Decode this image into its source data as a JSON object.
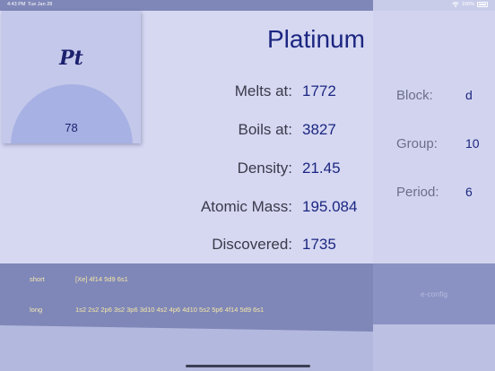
{
  "status_bar": {
    "time": "4:43 PM",
    "date": "Tue Jan 28",
    "battery": "100%"
  },
  "element": {
    "symbol": "Pt",
    "name": "Platinum",
    "atomic_number": "78"
  },
  "properties": [
    {
      "label": "Melts at:",
      "value": "1772"
    },
    {
      "label": "Boils at:",
      "value": "3827"
    },
    {
      "label": "Density:",
      "value": "21.45"
    },
    {
      "label": "Atomic Mass:",
      "value": "195.084"
    },
    {
      "label": "Discovered:",
      "value": "1735"
    }
  ],
  "side_properties": [
    {
      "label": "Block:",
      "value": "d"
    },
    {
      "label": "Group:",
      "value": "10"
    },
    {
      "label": "Period:",
      "value": "6"
    }
  ],
  "econfig": {
    "title": "e-config",
    "short_label": "short",
    "short_value": "[Xe] 4f14 5d9 6s1",
    "long_label": "long",
    "long_value": "1s2 2s2 2p6 3s2 3p6 3d10 4s2 4p6 4d10 5s2 5p6 4f14 5d9 6s1"
  },
  "colors": {
    "accent": "#1b2680",
    "panel": "#d6d8f2",
    "band": "#7f87b8",
    "econfig_text": "#f6e7a6"
  }
}
